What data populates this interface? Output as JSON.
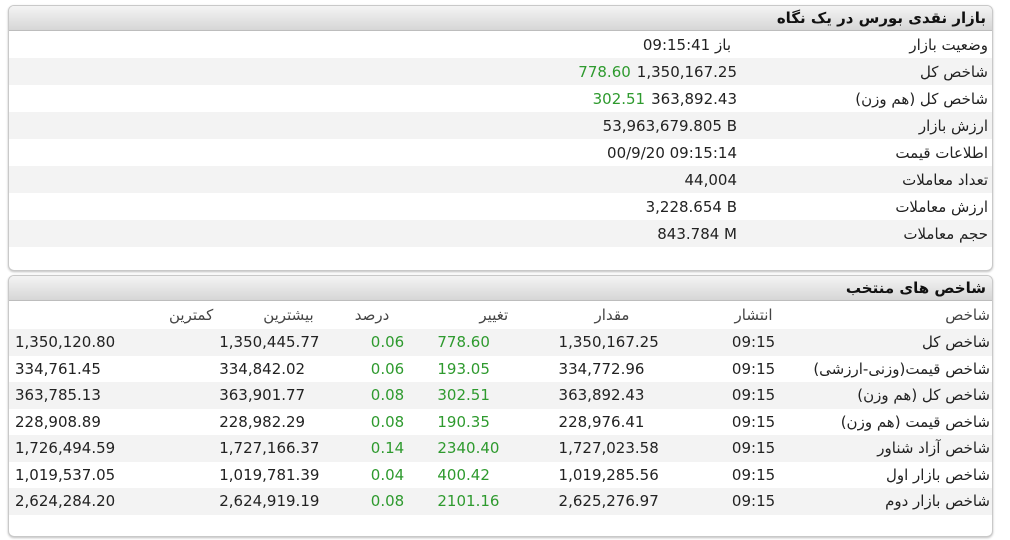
{
  "overview": {
    "title": "بازار نقدی بورس در یک نگاه",
    "rows": [
      {
        "label": "وضعیت بازار",
        "value": "باز 09:15:41",
        "change": ""
      },
      {
        "label": "شاخص کل",
        "value": "1,350,167.25",
        "change": "778.60"
      },
      {
        "label": "شاخص کل (هم وزن)",
        "value": "363,892.43",
        "change": "302.51"
      },
      {
        "label": "ارزش بازار",
        "value": "53,963,679.805 B",
        "change": ""
      },
      {
        "label": "اطلاعات قیمت",
        "value": "00/9/20 09:15:14",
        "change": ""
      },
      {
        "label": "تعداد معاملات",
        "value": "44,004",
        "change": ""
      },
      {
        "label": "ارزش معاملات",
        "value": "3,228.654 B",
        "change": ""
      },
      {
        "label": "حجم معاملات",
        "value": "843.784 M",
        "change": ""
      }
    ]
  },
  "indices": {
    "title": "شاخص های منتخب",
    "headers": {
      "name": "شاخص",
      "time": "انتشار",
      "amount": "مقدار",
      "change": "تغییر",
      "percent": "درصد",
      "high": "بیشترین",
      "low": "کمترین"
    },
    "rows": [
      {
        "name": "شاخص کل",
        "time": "09:15",
        "amount": "1,350,167.25",
        "change": "778.60",
        "percent": "0.06",
        "high": "1,350,445.77",
        "low": "1,350,120.80"
      },
      {
        "name": "شاخص قیمت(وزنی-ارزشی)",
        "time": "09:15",
        "amount": "334,772.96",
        "change": "193.05",
        "percent": "0.06",
        "high": "334,842.02",
        "low": "334,761.45"
      },
      {
        "name": "شاخص کل (هم وزن)",
        "time": "09:15",
        "amount": "363,892.43",
        "change": "302.51",
        "percent": "0.08",
        "high": "363,901.77",
        "low": "363,785.13"
      },
      {
        "name": "شاخص قیمت (هم وزن)",
        "time": "09:15",
        "amount": "228,976.41",
        "change": "190.35",
        "percent": "0.08",
        "high": "228,982.29",
        "low": "228,908.89"
      },
      {
        "name": "شاخص آزاد شناور",
        "time": "09:15",
        "amount": "1,727,023.58",
        "change": "2340.40",
        "percent": "0.14",
        "high": "1,727,166.37",
        "low": "1,726,494.59"
      },
      {
        "name": "شاخص بازار اول",
        "time": "09:15",
        "amount": "1,019,285.56",
        "change": "400.42",
        "percent": "0.04",
        "high": "1,019,781.39",
        "low": "1,019,537.05"
      },
      {
        "name": "شاخص بازار دوم",
        "time": "09:15",
        "amount": "2,625,276.97",
        "change": "2101.16",
        "percent": "0.08",
        "high": "2,624,919.19",
        "low": "2,624,284.20"
      }
    ]
  },
  "colors": {
    "positive": "#2e9a2e",
    "header_bg": "#d6d6d6"
  }
}
